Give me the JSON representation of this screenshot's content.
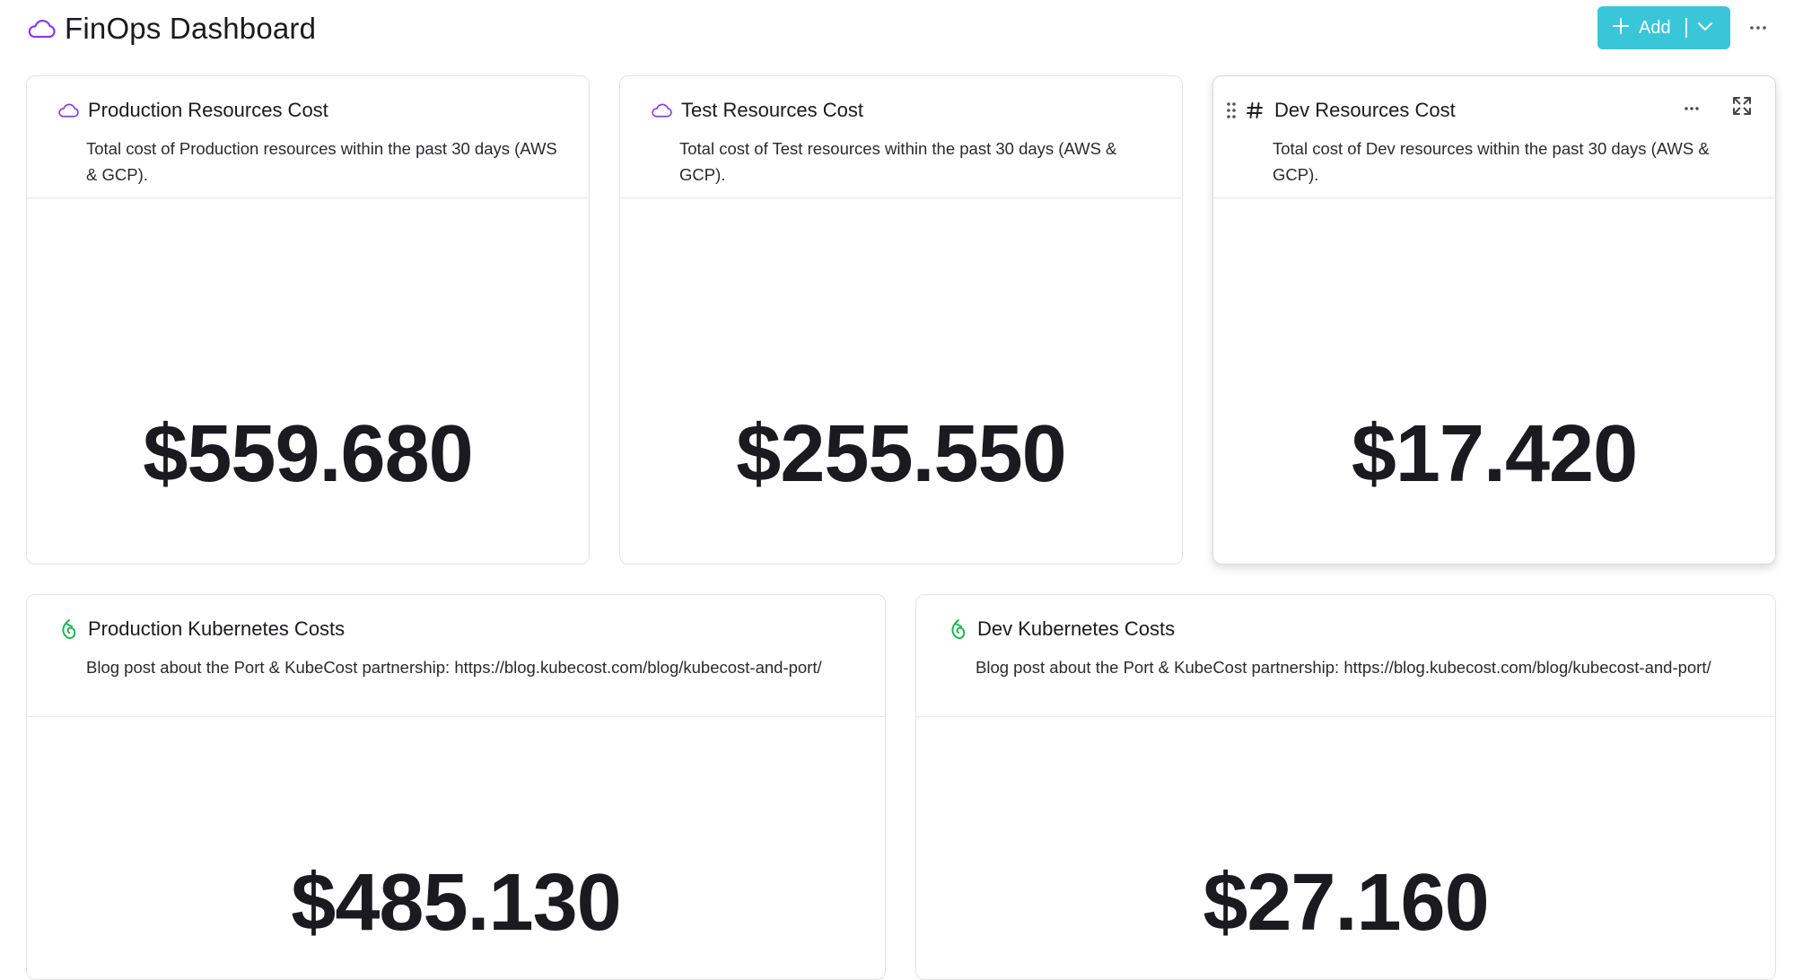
{
  "header": {
    "title": "FinOps Dashboard",
    "title_icon": "cloud-icon",
    "add_label": "Add",
    "accent_color": "#39c6d9"
  },
  "widgets": [
    {
      "title": "Production Resources Cost",
      "icon": "cloud-icon",
      "description": "Total cost of Production resources within the past 30 days (AWS & GCP).",
      "value": "$559.680"
    },
    {
      "title": "Test Resources Cost",
      "icon": "cloud-icon",
      "description": "Total cost of Test resources within the past 30 days (AWS & GCP).",
      "value": "$255.550"
    },
    {
      "title": "Dev Resources Cost",
      "icon": "hash-icon",
      "description": "Total cost of Dev resources within the past 30 days (AWS & GCP).",
      "value": "$17.420"
    },
    {
      "title": "Production Kubernetes Costs",
      "icon": "kubecost-icon",
      "description": "Blog post about the Port & KubeCost partnership: https://blog.kubecost.com/blog/kubecost-and-port/",
      "value": "$485.130"
    },
    {
      "title": "Dev Kubernetes Costs",
      "icon": "kubecost-icon",
      "description": "Blog post about the Port & KubeCost partnership: https://blog.kubecost.com/blog/kubecost-and-port/",
      "value": "$27.160"
    }
  ]
}
